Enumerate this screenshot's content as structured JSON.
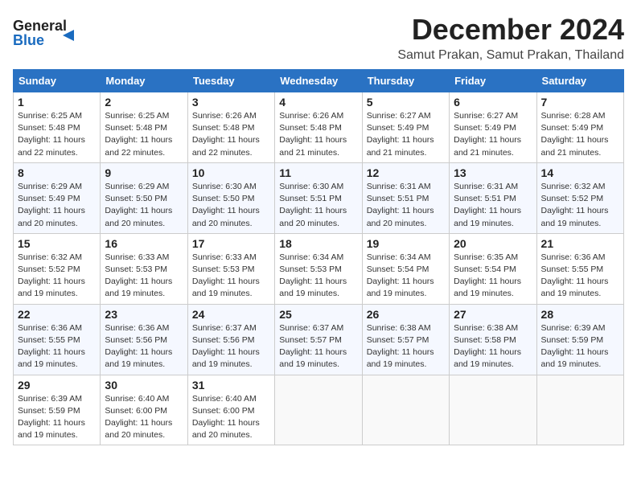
{
  "header": {
    "logo_general": "General",
    "logo_blue": "Blue",
    "title": "December 2024",
    "subtitle": "Samut Prakan, Samut Prakan, Thailand"
  },
  "weekdays": [
    "Sunday",
    "Monday",
    "Tuesday",
    "Wednesday",
    "Thursday",
    "Friday",
    "Saturday"
  ],
  "weeks": [
    [
      {
        "day": "1",
        "sunrise": "Sunrise: 6:25 AM",
        "sunset": "Sunset: 5:48 PM",
        "daylight": "Daylight: 11 hours and 22 minutes."
      },
      {
        "day": "2",
        "sunrise": "Sunrise: 6:25 AM",
        "sunset": "Sunset: 5:48 PM",
        "daylight": "Daylight: 11 hours and 22 minutes."
      },
      {
        "day": "3",
        "sunrise": "Sunrise: 6:26 AM",
        "sunset": "Sunset: 5:48 PM",
        "daylight": "Daylight: 11 hours and 22 minutes."
      },
      {
        "day": "4",
        "sunrise": "Sunrise: 6:26 AM",
        "sunset": "Sunset: 5:48 PM",
        "daylight": "Daylight: 11 hours and 21 minutes."
      },
      {
        "day": "5",
        "sunrise": "Sunrise: 6:27 AM",
        "sunset": "Sunset: 5:49 PM",
        "daylight": "Daylight: 11 hours and 21 minutes."
      },
      {
        "day": "6",
        "sunrise": "Sunrise: 6:27 AM",
        "sunset": "Sunset: 5:49 PM",
        "daylight": "Daylight: 11 hours and 21 minutes."
      },
      {
        "day": "7",
        "sunrise": "Sunrise: 6:28 AM",
        "sunset": "Sunset: 5:49 PM",
        "daylight": "Daylight: 11 hours and 21 minutes."
      }
    ],
    [
      {
        "day": "8",
        "sunrise": "Sunrise: 6:29 AM",
        "sunset": "Sunset: 5:49 PM",
        "daylight": "Daylight: 11 hours and 20 minutes."
      },
      {
        "day": "9",
        "sunrise": "Sunrise: 6:29 AM",
        "sunset": "Sunset: 5:50 PM",
        "daylight": "Daylight: 11 hours and 20 minutes."
      },
      {
        "day": "10",
        "sunrise": "Sunrise: 6:30 AM",
        "sunset": "Sunset: 5:50 PM",
        "daylight": "Daylight: 11 hours and 20 minutes."
      },
      {
        "day": "11",
        "sunrise": "Sunrise: 6:30 AM",
        "sunset": "Sunset: 5:51 PM",
        "daylight": "Daylight: 11 hours and 20 minutes."
      },
      {
        "day": "12",
        "sunrise": "Sunrise: 6:31 AM",
        "sunset": "Sunset: 5:51 PM",
        "daylight": "Daylight: 11 hours and 20 minutes."
      },
      {
        "day": "13",
        "sunrise": "Sunrise: 6:31 AM",
        "sunset": "Sunset: 5:51 PM",
        "daylight": "Daylight: 11 hours and 19 minutes."
      },
      {
        "day": "14",
        "sunrise": "Sunrise: 6:32 AM",
        "sunset": "Sunset: 5:52 PM",
        "daylight": "Daylight: 11 hours and 19 minutes."
      }
    ],
    [
      {
        "day": "15",
        "sunrise": "Sunrise: 6:32 AM",
        "sunset": "Sunset: 5:52 PM",
        "daylight": "Daylight: 11 hours and 19 minutes."
      },
      {
        "day": "16",
        "sunrise": "Sunrise: 6:33 AM",
        "sunset": "Sunset: 5:53 PM",
        "daylight": "Daylight: 11 hours and 19 minutes."
      },
      {
        "day": "17",
        "sunrise": "Sunrise: 6:33 AM",
        "sunset": "Sunset: 5:53 PM",
        "daylight": "Daylight: 11 hours and 19 minutes."
      },
      {
        "day": "18",
        "sunrise": "Sunrise: 6:34 AM",
        "sunset": "Sunset: 5:53 PM",
        "daylight": "Daylight: 11 hours and 19 minutes."
      },
      {
        "day": "19",
        "sunrise": "Sunrise: 6:34 AM",
        "sunset": "Sunset: 5:54 PM",
        "daylight": "Daylight: 11 hours and 19 minutes."
      },
      {
        "day": "20",
        "sunrise": "Sunrise: 6:35 AM",
        "sunset": "Sunset: 5:54 PM",
        "daylight": "Daylight: 11 hours and 19 minutes."
      },
      {
        "day": "21",
        "sunrise": "Sunrise: 6:36 AM",
        "sunset": "Sunset: 5:55 PM",
        "daylight": "Daylight: 11 hours and 19 minutes."
      }
    ],
    [
      {
        "day": "22",
        "sunrise": "Sunrise: 6:36 AM",
        "sunset": "Sunset: 5:55 PM",
        "daylight": "Daylight: 11 hours and 19 minutes."
      },
      {
        "day": "23",
        "sunrise": "Sunrise: 6:36 AM",
        "sunset": "Sunset: 5:56 PM",
        "daylight": "Daylight: 11 hours and 19 minutes."
      },
      {
        "day": "24",
        "sunrise": "Sunrise: 6:37 AM",
        "sunset": "Sunset: 5:56 PM",
        "daylight": "Daylight: 11 hours and 19 minutes."
      },
      {
        "day": "25",
        "sunrise": "Sunrise: 6:37 AM",
        "sunset": "Sunset: 5:57 PM",
        "daylight": "Daylight: 11 hours and 19 minutes."
      },
      {
        "day": "26",
        "sunrise": "Sunrise: 6:38 AM",
        "sunset": "Sunset: 5:57 PM",
        "daylight": "Daylight: 11 hours and 19 minutes."
      },
      {
        "day": "27",
        "sunrise": "Sunrise: 6:38 AM",
        "sunset": "Sunset: 5:58 PM",
        "daylight": "Daylight: 11 hours and 19 minutes."
      },
      {
        "day": "28",
        "sunrise": "Sunrise: 6:39 AM",
        "sunset": "Sunset: 5:59 PM",
        "daylight": "Daylight: 11 hours and 19 minutes."
      }
    ],
    [
      {
        "day": "29",
        "sunrise": "Sunrise: 6:39 AM",
        "sunset": "Sunset: 5:59 PM",
        "daylight": "Daylight: 11 hours and 19 minutes."
      },
      {
        "day": "30",
        "sunrise": "Sunrise: 6:40 AM",
        "sunset": "Sunset: 6:00 PM",
        "daylight": "Daylight: 11 hours and 20 minutes."
      },
      {
        "day": "31",
        "sunrise": "Sunrise: 6:40 AM",
        "sunset": "Sunset: 6:00 PM",
        "daylight": "Daylight: 11 hours and 20 minutes."
      },
      null,
      null,
      null,
      null
    ]
  ]
}
